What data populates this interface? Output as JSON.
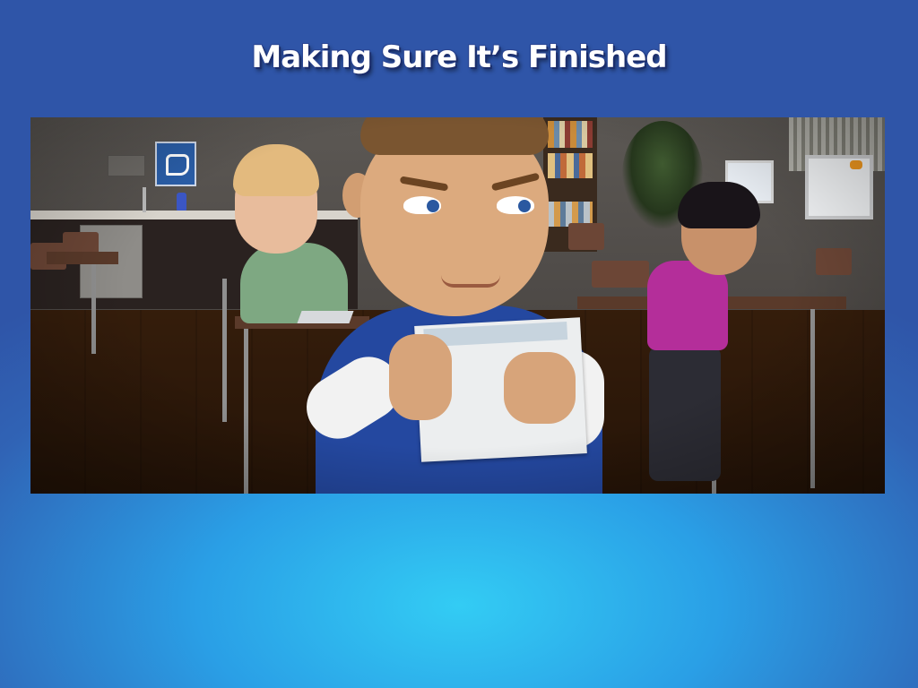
{
  "slide": {
    "title": "Making Sure It’s Finished",
    "background_colors": {
      "edge": "#2f55a8",
      "center_glow": "#33ccf4"
    }
  },
  "scene": {
    "image_kind": "3d-classroom-animation-still",
    "palette": {
      "floor": "#6e5234",
      "boy_shirt": "#2448a0",
      "girl_shirt_green": "#7ea882",
      "girl_shirt_purple": "#b42e9a"
    }
  }
}
